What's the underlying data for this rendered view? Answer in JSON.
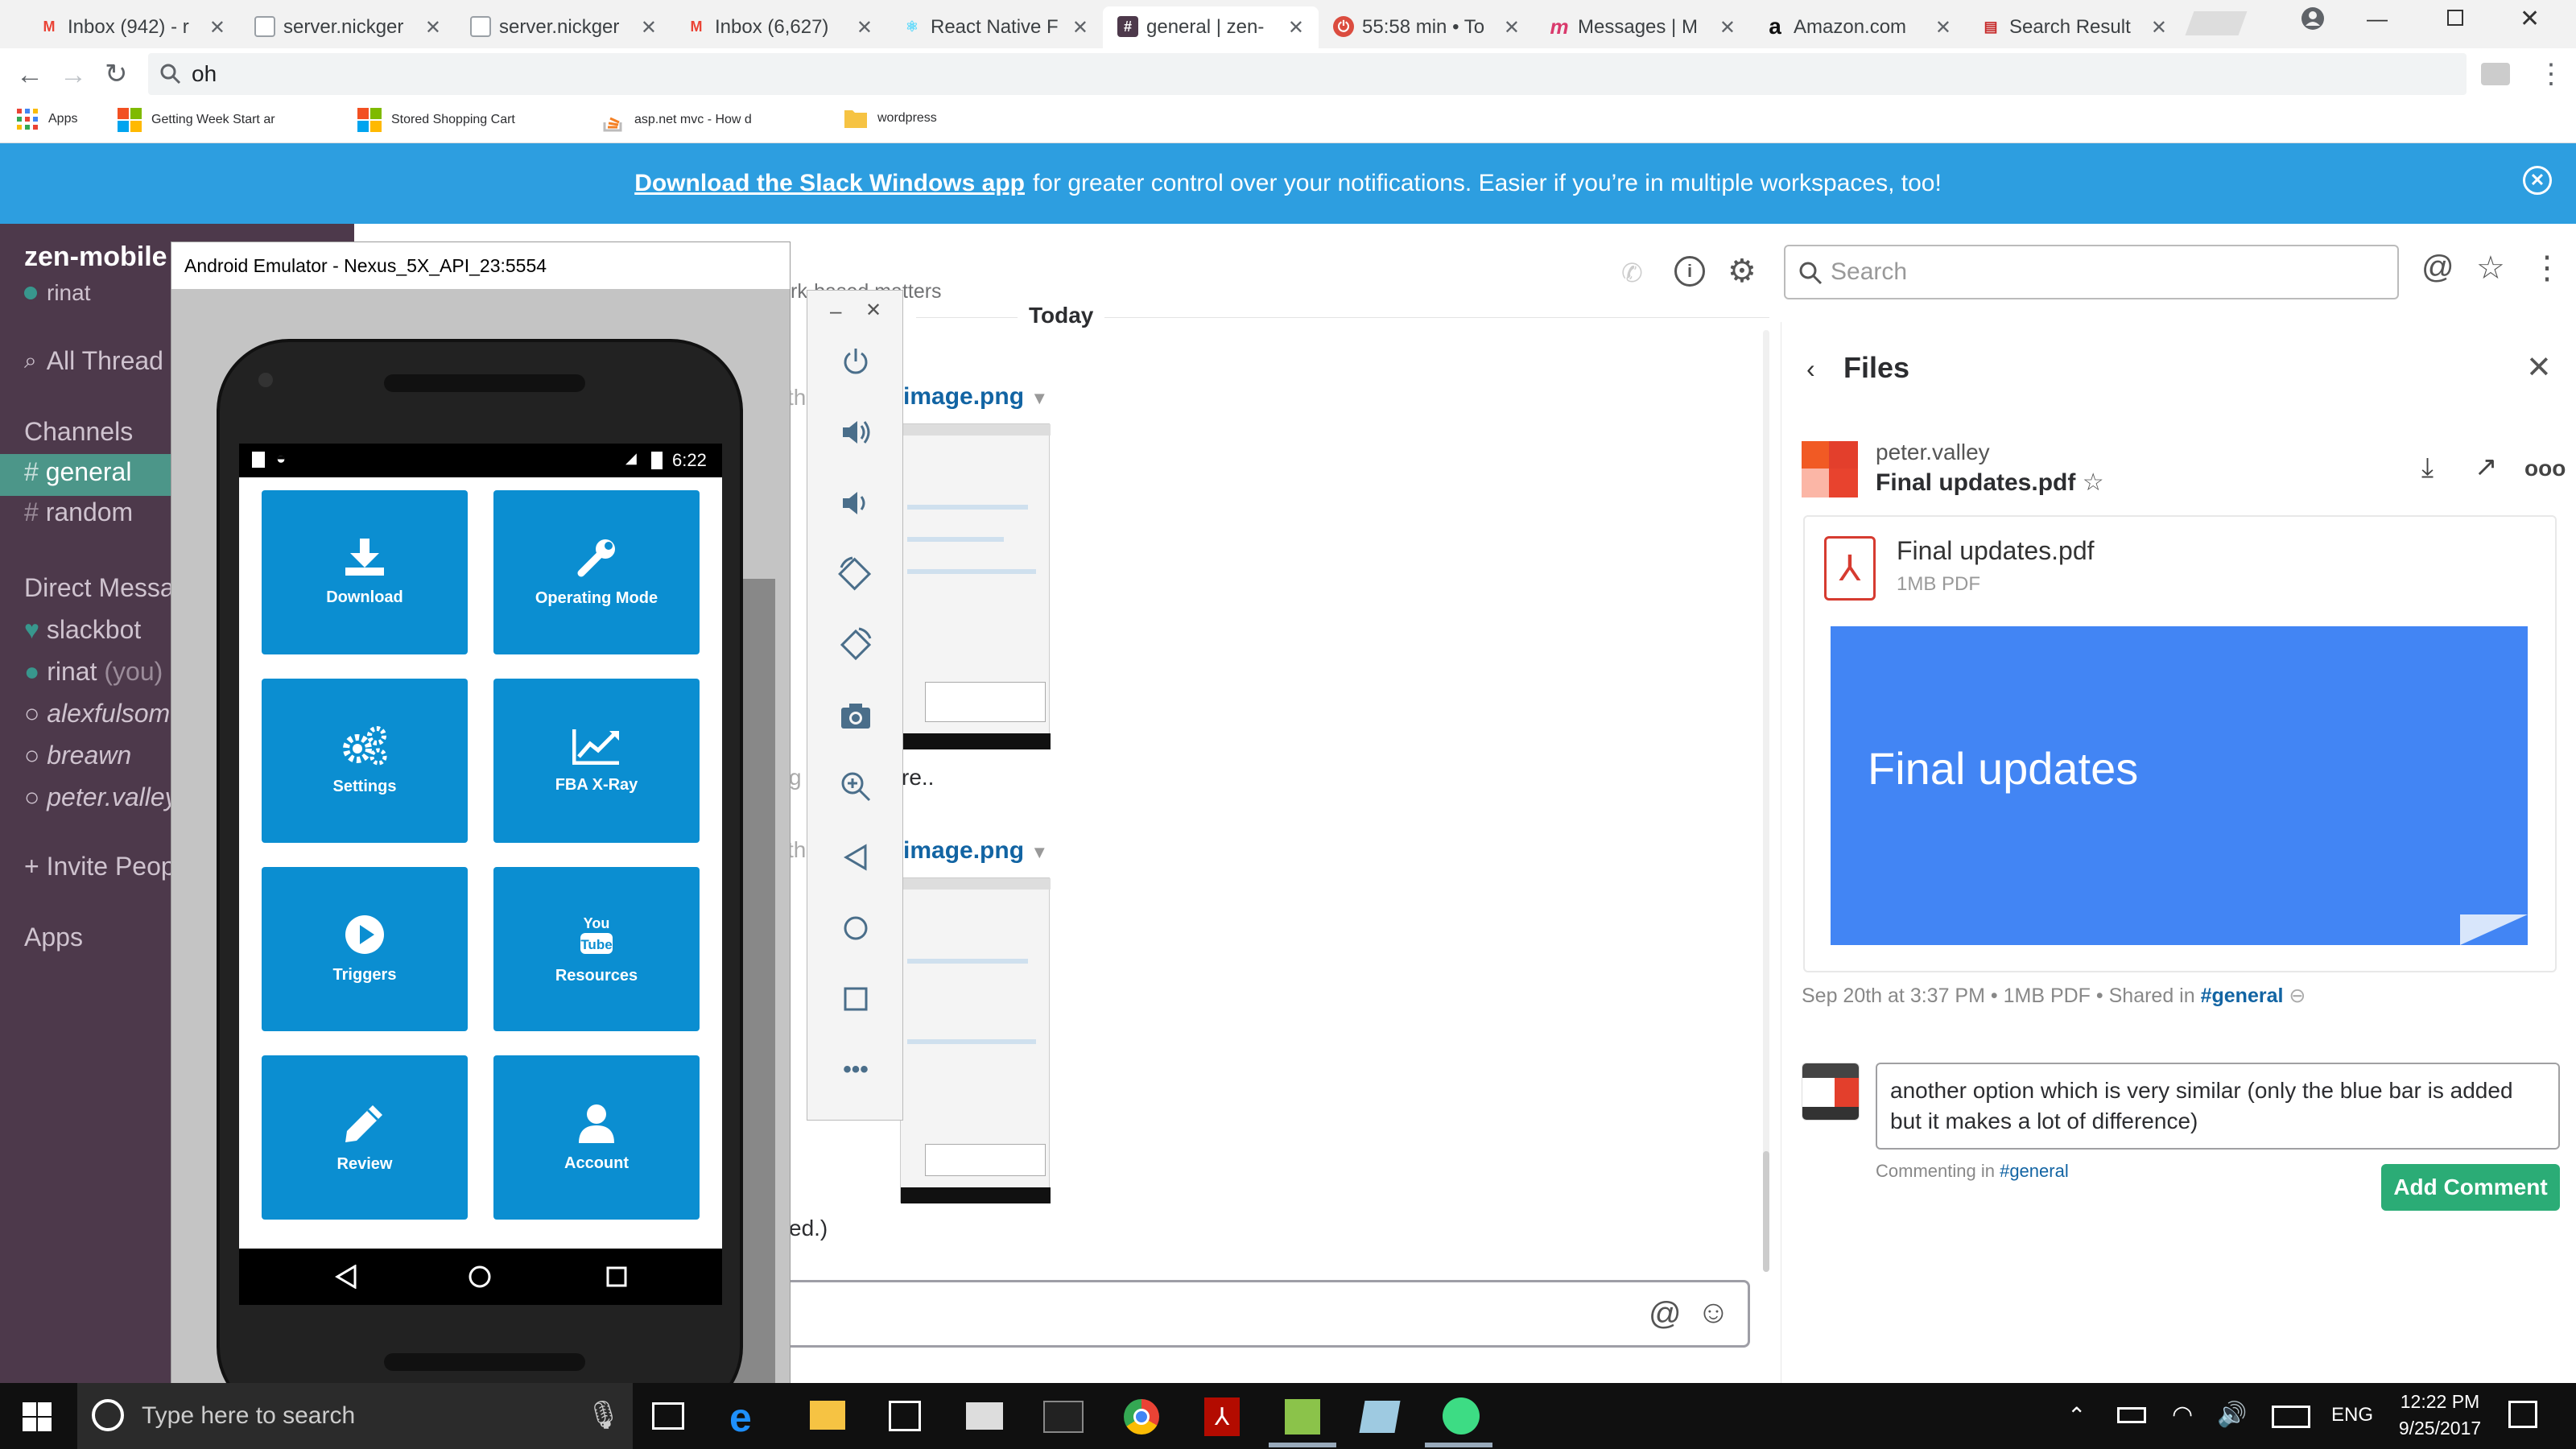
{
  "browser": {
    "tabs": [
      {
        "title": "Inbox (942) - r",
        "icon": "gmail-icon",
        "color": "#ea4335",
        "letter": "M"
      },
      {
        "title": "server.nickger",
        "icon": "page-icon",
        "color": "#9aa0a6",
        "letter": ""
      },
      {
        "title": "server.nickger",
        "icon": "page-icon",
        "color": "#9aa0a6",
        "letter": ""
      },
      {
        "title": "Inbox (6,627)",
        "icon": "gmail-icon",
        "color": "#ea4335",
        "letter": "M"
      },
      {
        "title": "React Native F",
        "icon": "react-icon",
        "color": "#61dafb",
        "letter": "⚛"
      },
      {
        "title": "general | zen-",
        "icon": "slack-icon",
        "color": "#4d394b",
        "letter": "#"
      },
      {
        "title": "55:58 min • To",
        "icon": "timer-icon",
        "color": "#db4c3f",
        "letter": "⏻"
      },
      {
        "title": "Messages | M",
        "icon": "messenger-icon",
        "color": "#d93a6c",
        "letter": "m"
      },
      {
        "title": "Amazon.com",
        "icon": "amazon-icon",
        "color": "#111111",
        "letter": "a"
      },
      {
        "title": "Search Result",
        "icon": "search-result-icon",
        "color": "#c62828",
        "letter": "▤"
      }
    ],
    "address_value": "oh",
    "bookmarks": [
      {
        "label": "Apps",
        "icon": "apps-grid-icon"
      },
      {
        "label": "Getting Week Start ar",
        "icon": "windows-logo-icon"
      },
      {
        "label": "Stored Shopping Cart",
        "icon": "windows-logo-icon"
      },
      {
        "label": "asp.net mvc - How d",
        "icon": "stackoverflow-icon"
      },
      {
        "label": "wordpress",
        "icon": "folder-icon"
      }
    ]
  },
  "banner": {
    "link": "Download the Slack Windows app",
    "text": "for greater control over your notifications. Easier if you’re in multiple workspaces, too!"
  },
  "slack": {
    "team": "zen-mobile",
    "user": "rinat",
    "all_threads": "All Thread",
    "channels_header": "Channels",
    "channels": [
      "general",
      "random"
    ],
    "dm_header": "Direct Messa",
    "dms": [
      {
        "name": "slackbot",
        "suffix": ""
      },
      {
        "name": "rinat",
        "suffix": " (you)"
      },
      {
        "name": "alexfulsome",
        "suffix": ""
      },
      {
        "name": "breawn",
        "suffix": ""
      },
      {
        "name": "peter.valley",
        "suffix": ""
      }
    ],
    "invite": "Invite Peop",
    "apps": "Apps",
    "channel_topic": "rk-based matters",
    "day_divider": "Today",
    "search_placeholder": "Search",
    "messages": [
      {
        "file": "image.png",
        "prefix": "th"
      },
      {
        "caption_fragment": "re..",
        "prefix": "g"
      },
      {
        "file": "image.png",
        "prefix": "th"
      },
      {
        "caption_fragment": "ed.)"
      }
    ]
  },
  "files_panel": {
    "title": "Files",
    "author": "peter.valley",
    "file_name": "Final updates.pdf",
    "file_meta": "1MB PDF",
    "preview_title": "Final updates",
    "shared_date": "Sep 20th at 3:37 PM",
    "shared_size": "1MB PDF",
    "shared_in_label": "Shared in",
    "shared_channel": "#general",
    "comment_text": "another option which is very similar (only the blue bar is added but it makes a lot of difference)",
    "commenting_label": "Commenting in",
    "commenting_channel": "#general",
    "add_comment": "Add Comment"
  },
  "emulator": {
    "title": "Android Emulator - Nexus_5X_API_23:5554",
    "time": "6:22",
    "tiles": [
      {
        "label": "Download",
        "icon": "download-icon"
      },
      {
        "label": "Operating Mode",
        "icon": "wrench-icon"
      },
      {
        "label": "Settings",
        "icon": "gears-icon"
      },
      {
        "label": "FBA X-Ray",
        "icon": "chart-line-icon"
      },
      {
        "label": "Triggers",
        "icon": "play-icon"
      },
      {
        "label": "Resources",
        "icon": "youtube-icon"
      },
      {
        "label": "Review",
        "icon": "pencil-icon"
      },
      {
        "label": "Account",
        "icon": "user-icon"
      }
    ],
    "toolbar": [
      "power-icon",
      "volume-up-icon",
      "volume-down-icon",
      "rotate-left-icon",
      "rotate-right-icon",
      "camera-icon",
      "zoom-icon",
      "back-icon",
      "home-icon",
      "overview-icon",
      "more-icon"
    ]
  },
  "taskbar": {
    "search_placeholder": "Type here to search",
    "lang": "ENG",
    "time": "12:22 PM",
    "date": "9/25/2017"
  },
  "colors": {
    "slack_sidebar": "#4d394b",
    "slack_active": "#4c9689",
    "banner": "#2d9ee0",
    "tile_blue": "#0b8ed1",
    "add_comment_green": "#2bac76",
    "preview_blue": "#4285f4",
    "link_blue": "#1264a3"
  }
}
